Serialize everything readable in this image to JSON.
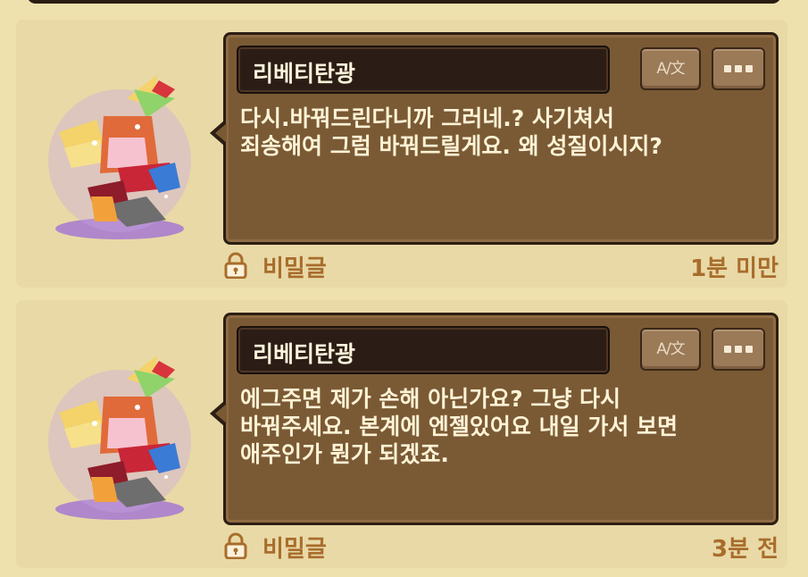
{
  "messages": [
    {
      "author": "리베티탄광",
      "text": "다시.바꿔드린다니까 그러네.? 사기쳐서\n죄송해여 그럼 바꿔드릴게요. 왜 성질이시지?",
      "privacy_label": "비밀글",
      "time": "1분 미만",
      "translate_icon": "A/文",
      "more_icon": "more-dots-icon",
      "avatar_icon": "phoenix-avatar-icon"
    },
    {
      "author": "리베티탄광",
      "text": "에그주면 제가 손해 아닌가요? 그냥 다시\n바꿔주세요. 본계에 엔젤있어요 내일 가서 보면\n애주인가 뭔가 되겠죠.",
      "privacy_label": "비밀글",
      "time": "3분 전",
      "translate_icon": "A/文",
      "more_icon": "more-dots-icon",
      "avatar_icon": "phoenix-avatar-icon"
    }
  ],
  "colors": {
    "background": "#efe1ae",
    "bubble": "#7a5a35",
    "name_bar": "#2b1d15",
    "accent_text": "#a86d2c"
  }
}
